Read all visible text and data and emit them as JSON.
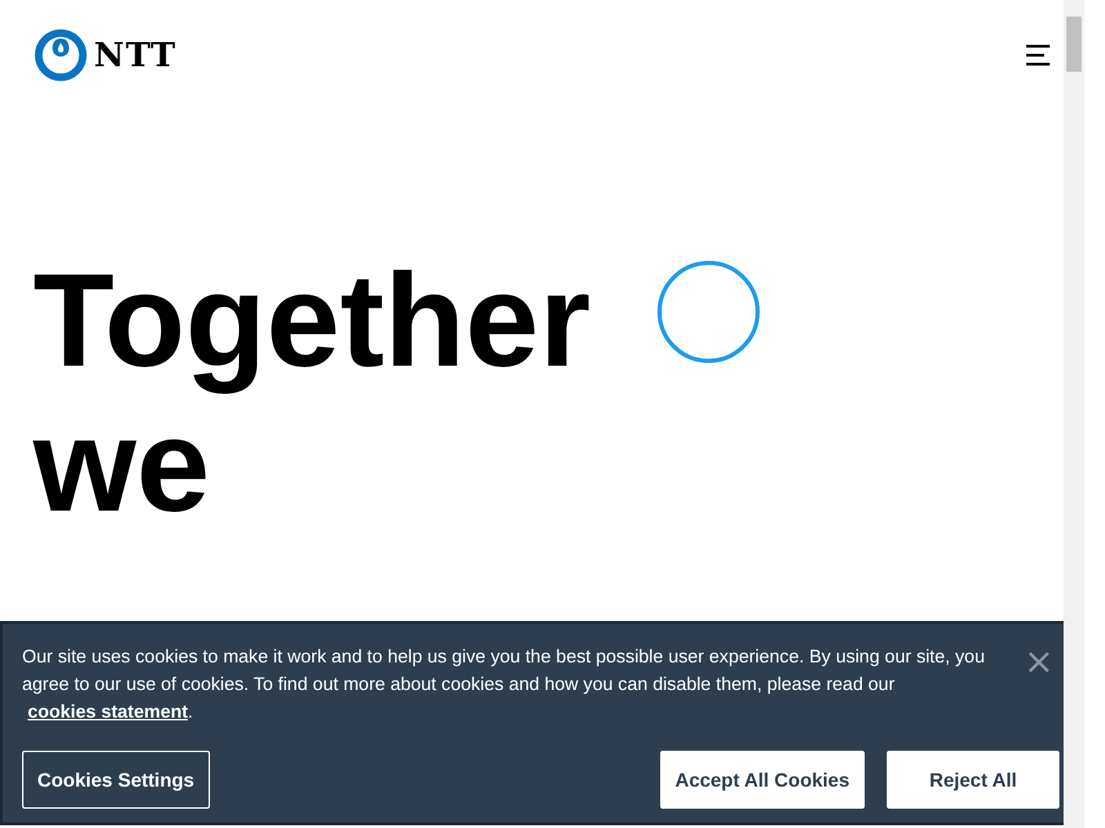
{
  "header": {
    "logo_text": "NTT"
  },
  "hero": {
    "lines": [
      {
        "text": "Together",
        "kind": "bold"
      },
      {
        "text": "we",
        "kind": "bold"
      }
    ]
  },
  "cookie_banner": {
    "message": "Our site uses cookies to make it work and to help us give you the best possible user experience. By using our site, you agree to our use of cookies. To find out more about cookies and how you can disable them, please read our",
    "link": "cookies statement",
    "after_link": ".",
    "close": "×",
    "buttons": [
      {
        "label": "Cookies Settings",
        "kind": "outline"
      },
      {
        "label": "Accept All Cookies",
        "kind": "solid"
      },
      {
        "label": "Reject All",
        "kind": "solid"
      }
    ]
  }
}
